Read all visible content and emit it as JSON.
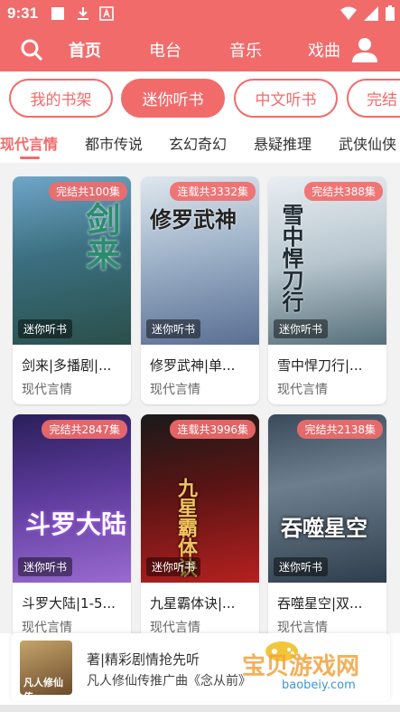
{
  "status_bar": {
    "time": "9:31"
  },
  "nav": {
    "tabs": [
      "首页",
      "电台",
      "音乐",
      "戏曲"
    ],
    "active_index": 0
  },
  "pills": [
    "我的书架",
    "迷你听书",
    "中文听书",
    "完结"
  ],
  "active_pill": 1,
  "categories": [
    "现代言情",
    "都市传说",
    "玄幻奇幻",
    "悬疑推理",
    "武侠仙侠"
  ],
  "active_category": 0,
  "books": [
    {
      "title": "剑来|多播剧|...",
      "genre": "现代言情",
      "badge": "完结共100集",
      "tag": "迷你听书",
      "cover_text": "剑来"
    },
    {
      "title": "修罗武神|单...",
      "genre": "现代言情",
      "badge": "连载共3332集",
      "tag": "迷你听书",
      "cover_text": "修罗武神"
    },
    {
      "title": "雪中悍刀行|...",
      "genre": "现代言情",
      "badge": "完结共388集",
      "tag": "迷你听书",
      "cover_text": "雪中悍刀行"
    },
    {
      "title": "斗罗大陆|1-5...",
      "genre": "现代言情",
      "badge": "完结共2847集",
      "tag": "迷你听书",
      "cover_text": "斗罗大陆"
    },
    {
      "title": "九星霸体诀|...",
      "genre": "现代言情",
      "badge": "连载共3996集",
      "tag": "迷你听书",
      "cover_text": "九星霸体诀"
    },
    {
      "title": "吞噬星空|双...",
      "genre": "现代言情",
      "badge": "完结共2138集",
      "tag": "迷你听书",
      "cover_text": "吞噬星空"
    }
  ],
  "ad": {
    "line1": "著|精彩剧情抢先听",
    "line2": "凡人修仙传推广曲《念从前》",
    "thumb_text": "凡人修仙传",
    "watermark": "宝贝游戏网",
    "watermark_url": "baobeiy.com"
  },
  "colors": {
    "accent": "#f26b6b"
  },
  "icons": {
    "search": "search-icon",
    "user": "user-icon",
    "download": "download-icon",
    "wifi": "wifi-icon",
    "signal": "signal-icon",
    "battery": "battery-icon"
  }
}
